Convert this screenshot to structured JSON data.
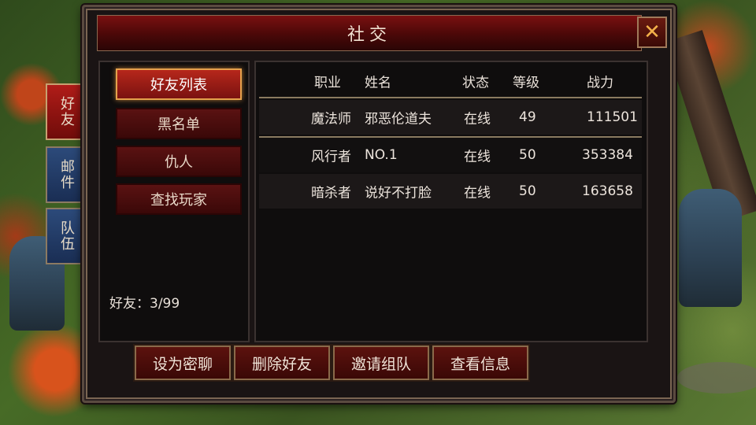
{
  "window": {
    "title": "社交",
    "close_icon": "close-icon"
  },
  "side_tabs": [
    {
      "label": "好友",
      "active": true
    },
    {
      "label": "邮件",
      "active": false
    },
    {
      "label": "队伍",
      "active": false
    }
  ],
  "nav": [
    {
      "label": "好友列表",
      "active": true
    },
    {
      "label": "黑名单",
      "active": false
    },
    {
      "label": "仇人",
      "active": false
    },
    {
      "label": "查找玩家",
      "active": false
    }
  ],
  "friend_count": "好友：3/99",
  "table": {
    "headers": {
      "job": "职业",
      "name": "姓名",
      "status": "状态",
      "level": "等级",
      "power": "战力"
    },
    "rows": [
      {
        "job": "魔法师",
        "name": "邪恶伦道夫",
        "status": "在线",
        "level": "49",
        "power": "111501"
      },
      {
        "job": "风行者",
        "name": "NO.1",
        "status": "在线",
        "level": "50",
        "power": "353384"
      },
      {
        "job": "暗杀者",
        "name": "说好不打脸",
        "status": "在线",
        "level": "50",
        "power": "163658"
      }
    ]
  },
  "actions": [
    {
      "label": "设为密聊"
    },
    {
      "label": "删除好友"
    },
    {
      "label": "邀请组队"
    },
    {
      "label": "查看信息"
    }
  ],
  "colors": {
    "accent": "#b6271b",
    "highlight_border": "#e5a14c",
    "close_icon": "#f3b14a"
  }
}
